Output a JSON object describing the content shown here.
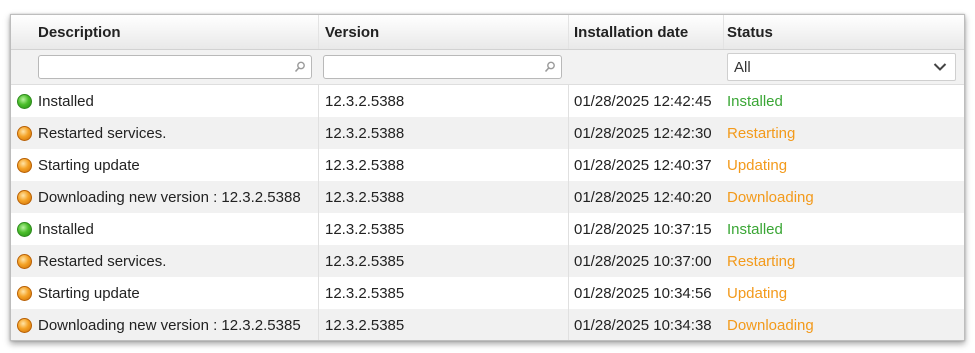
{
  "columns": {
    "description": "Description",
    "version": "Version",
    "installation_date": "Installation date",
    "status": "Status"
  },
  "filters": {
    "description_value": "",
    "version_value": "",
    "status_selected": "All"
  },
  "colors": {
    "installed": "#3aa635",
    "in_progress": "#f39a1b"
  },
  "rows": [
    {
      "description": "Installed",
      "version": "12.3.2.5388",
      "date": "01/28/2025 12:42:45",
      "status": "Installed",
      "state": "green"
    },
    {
      "description": "Restarted services.",
      "version": "12.3.2.5388",
      "date": "01/28/2025 12:42:30",
      "status": "Restarting",
      "state": "orange"
    },
    {
      "description": "Starting update",
      "version": "12.3.2.5388",
      "date": "01/28/2025 12:40:37",
      "status": "Updating",
      "state": "orange"
    },
    {
      "description": "Downloading new version : 12.3.2.5388",
      "version": "12.3.2.5388",
      "date": "01/28/2025 12:40:20",
      "status": "Downloading",
      "state": "orange"
    },
    {
      "description": "Installed",
      "version": "12.3.2.5385",
      "date": "01/28/2025 10:37:15",
      "status": "Installed",
      "state": "green"
    },
    {
      "description": "Restarted services.",
      "version": "12.3.2.5385",
      "date": "01/28/2025 10:37:00",
      "status": "Restarting",
      "state": "orange"
    },
    {
      "description": "Starting update",
      "version": "12.3.2.5385",
      "date": "01/28/2025 10:34:56",
      "status": "Updating",
      "state": "orange"
    },
    {
      "description": "Downloading new version : 12.3.2.5385",
      "version": "12.3.2.5385",
      "date": "01/28/2025 10:34:38",
      "status": "Downloading",
      "state": "orange"
    }
  ]
}
